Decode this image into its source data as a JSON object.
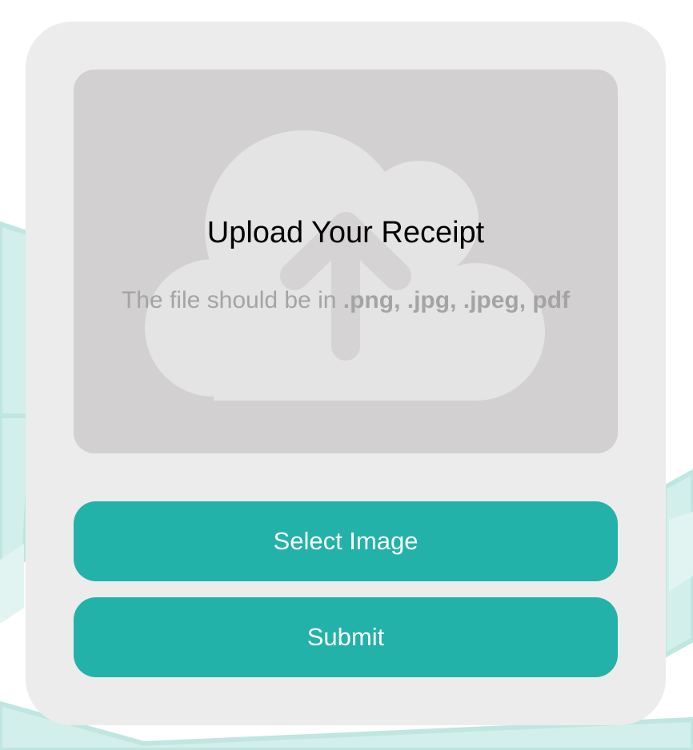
{
  "upload": {
    "title": "Upload Your Receipt",
    "hint_prefix": "The file should be in ",
    "hint_formats": ".png, .jpg, .jpeg, pdf",
    "icon": "cloud-upload-icon"
  },
  "actions": {
    "select_label": "Select Image",
    "submit_label": "Submit"
  },
  "colors": {
    "accent": "#22b2a9",
    "card": "#ececec",
    "dropzone": "#d2d0d1",
    "background_pattern": "#cfeeea"
  }
}
